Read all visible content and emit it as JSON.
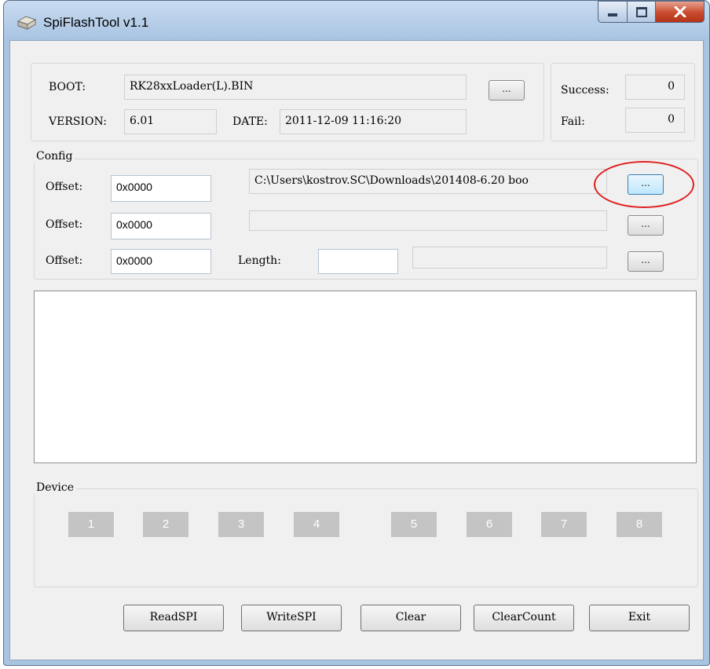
{
  "window": {
    "title": "SpiFlashTool v1.1",
    "icon": "app-icon",
    "controls": [
      "minimize-icon",
      "maximize-icon",
      "close-icon"
    ],
    "accent_color": "#a9c4e0",
    "close_color": "#c84a2c"
  },
  "header": {
    "boot_label": "BOOT:",
    "boot_value": "RK28xxLoader(L).BIN",
    "boot_browse": "...",
    "version_label": "VERSION:",
    "version_value": "6.01",
    "date_label": "DATE:",
    "date_value": "2011-12-09 11:16:20"
  },
  "counts": {
    "success_label": "Success:",
    "success_value": "0",
    "fail_label": "Fail:",
    "fail_value": "0"
  },
  "config": {
    "title": "Config",
    "row1": {
      "offset_label": "Offset:",
      "offset_value": "0x0000",
      "path": "C:\\Users\\kostrov.SC\\Downloads\\201408-6.20 boo",
      "browse": "..."
    },
    "row2": {
      "offset_label": "Offset:",
      "offset_value": "0x0000",
      "path": "",
      "browse": "..."
    },
    "row3": {
      "offset_label": "Offset:",
      "offset_value": "0x0000",
      "length_label": "Length:",
      "length_value": "",
      "path": "",
      "browse": "..."
    }
  },
  "log": {
    "text": ""
  },
  "device": {
    "title": "Device",
    "slots": [
      "1",
      "2",
      "3",
      "4",
      "5",
      "6",
      "7",
      "8"
    ],
    "slot_color": "#c4c4c4"
  },
  "actions": {
    "read": "ReadSPI",
    "write": "WriteSPI",
    "clear": "Clear",
    "clear_count": "ClearCount",
    "exit": "Exit"
  },
  "annotation": {
    "ring_color": "#e02020"
  }
}
